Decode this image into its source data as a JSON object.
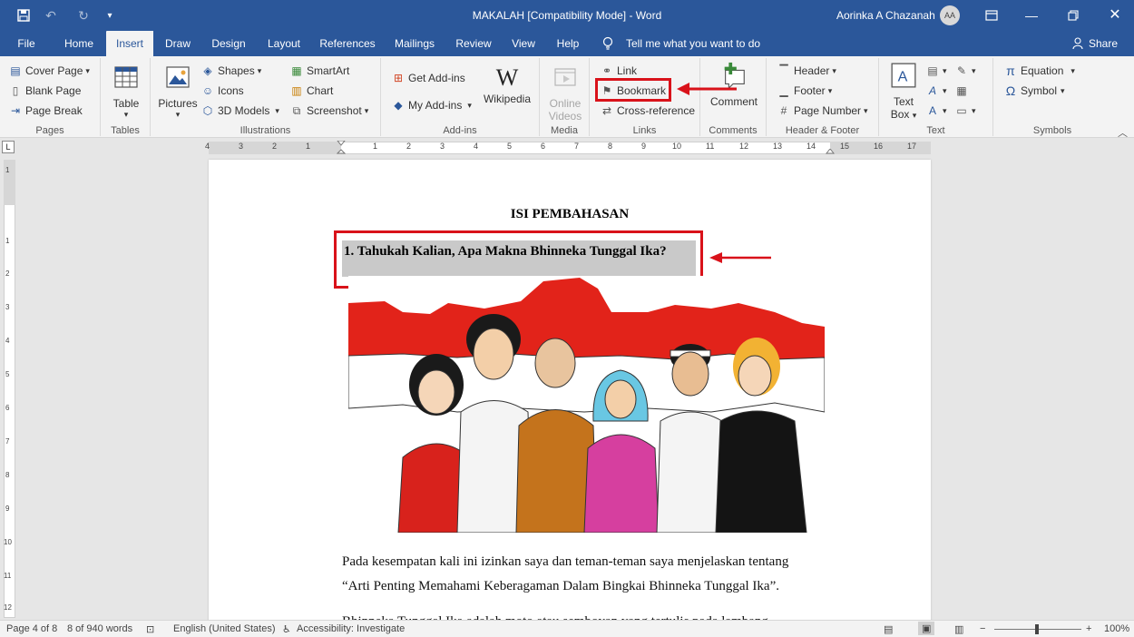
{
  "window": {
    "title": "MAKALAH [Compatibility Mode]  -  Word",
    "user_name": "Aorinka A Chazanah",
    "user_initials": "AA"
  },
  "tabs": [
    {
      "label": "File"
    },
    {
      "label": "Home"
    },
    {
      "label": "Insert"
    },
    {
      "label": "Draw"
    },
    {
      "label": "Design"
    },
    {
      "label": "Layout"
    },
    {
      "label": "References"
    },
    {
      "label": "Mailings"
    },
    {
      "label": "Review"
    },
    {
      "label": "View"
    },
    {
      "label": "Help"
    }
  ],
  "tell_me": "Tell me what you want to do",
  "share_label": "Share",
  "ribbon": {
    "pages": {
      "label": "Pages",
      "cover_page": "Cover Page",
      "blank_page": "Blank Page",
      "page_break": "Page Break"
    },
    "tables": {
      "label": "Tables",
      "table": "Table"
    },
    "illustrations": {
      "label": "Illustrations",
      "pictures": "Pictures",
      "shapes": "Shapes",
      "icons": "Icons",
      "models_3d": "3D Models",
      "smartart": "SmartArt",
      "chart": "Chart",
      "screenshot": "Screenshot"
    },
    "addins": {
      "label": "Add-ins",
      "get_addins": "Get Add-ins",
      "my_addins": "My Add-ins",
      "wikipedia": "Wikipedia"
    },
    "media": {
      "label": "Media",
      "online_videos_1": "Online",
      "online_videos_2": "Videos"
    },
    "links": {
      "label": "Links",
      "link": "Link",
      "bookmark": "Bookmark",
      "cross_reference": "Cross-reference"
    },
    "comments": {
      "label": "Comments",
      "comment": "Comment"
    },
    "header_footer": {
      "label": "Header & Footer",
      "header": "Header",
      "footer": "Footer",
      "page_number": "Page Number"
    },
    "text": {
      "label": "Text",
      "text_box_1": "Text",
      "text_box_2": "Box"
    },
    "symbols": {
      "label": "Symbols",
      "equation": "Equation",
      "symbol": "Symbol"
    }
  },
  "ruler": {
    "numbers": [
      "4",
      "3",
      "2",
      "1",
      "1",
      "2",
      "3",
      "4",
      "5",
      "6",
      "7",
      "8",
      "9",
      "10",
      "11",
      "12",
      "13",
      "14",
      "15",
      "16",
      "17"
    ],
    "vnumbers": [
      "1",
      "1",
      "2",
      "3",
      "4",
      "5",
      "6",
      "7",
      "8",
      "9",
      "10",
      "11",
      "12"
    ]
  },
  "document": {
    "section_title": "ISI PEMBAHASAN",
    "heading": "1. Tahukah Kalian, Apa Makna Bhinneka Tunggal Ika?",
    "para1_line1": "Pada kesempatan kali ini izinkan  saya dan teman-teman saya menjelaskan tentang",
    "para1_line2": "“Arti Penting Memahami Keberagaman Dalam Bingkai Bhinneka Tunggal Ika”.",
    "para2_partial": "Bhinneka Tunggal Ika adalah moto atau semboyan yang tertulis pada lambang"
  },
  "status": {
    "page": "Page 4 of 8",
    "words": "8 of 940 words",
    "language": "English (United States)",
    "accessibility": "Accessibility: Investigate",
    "zoom": "100%"
  },
  "colors": {
    "titlebar": "#2b579a",
    "ribbon": "#f3f3f3",
    "highlight": "#d9121a",
    "flag_red": "#e2231a"
  }
}
